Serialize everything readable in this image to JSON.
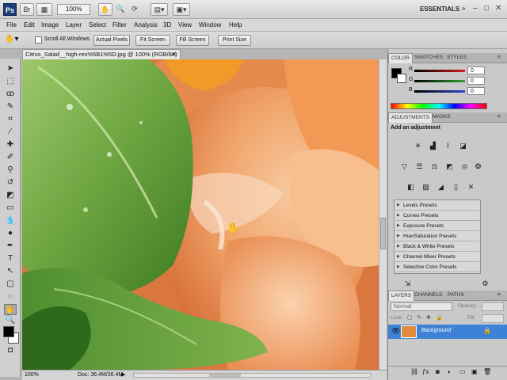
{
  "app": {
    "logo": "Ps",
    "zoom": "100%",
    "workspace": "ESSENTIALS",
    "window_controls": [
      "–",
      "□",
      "✕"
    ]
  },
  "menu": [
    "File",
    "Edit",
    "Image",
    "Layer",
    "Select",
    "Filter",
    "Analysis",
    "3D",
    "View",
    "Window",
    "Help"
  ],
  "options": {
    "scroll_all_windows": "Scroll All Windows",
    "buttons": [
      "Actual Pixels",
      "Fit Screen",
      "Fill Screen",
      "Print Size"
    ]
  },
  "document": {
    "tab_title": "Citrus_Salad__high-res%5B1%5D.jpg @ 100% (RGB/8#)",
    "zoom": "100%",
    "doc_info": "Doc: 36.4M/36.4M"
  },
  "color_panel": {
    "tabs": [
      "COLOR",
      "SWATCHES",
      "STYLES"
    ],
    "channels": [
      {
        "label": "R",
        "value": "0",
        "color": "#d81e1e"
      },
      {
        "label": "G",
        "value": "0",
        "color": "#2fa02f"
      },
      {
        "label": "B",
        "value": "0",
        "color": "#2e47d1"
      }
    ]
  },
  "adjustments_panel": {
    "tabs": [
      "ADJUSTMENTS",
      "MASKS"
    ],
    "heading": "Add an adjustment",
    "presets": [
      "Levels Presets",
      "Curves Presets",
      "Exposure Presets",
      "Hue/Saturation Presets",
      "Black & White Presets",
      "Channel Mixer Presets",
      "Selective Color Presets"
    ]
  },
  "layers_panel": {
    "tabs": [
      "LAYERS",
      "CHANNELS",
      "PATHS"
    ],
    "blend_mode": "Normal",
    "opacity_label": "Opacity:",
    "lock_label": "Lock:",
    "fill_label": "Fill:",
    "layer_name": "Background"
  },
  "colors": {
    "accent_blue": "#3d82d6",
    "selected_layer": "#3d82d6"
  }
}
